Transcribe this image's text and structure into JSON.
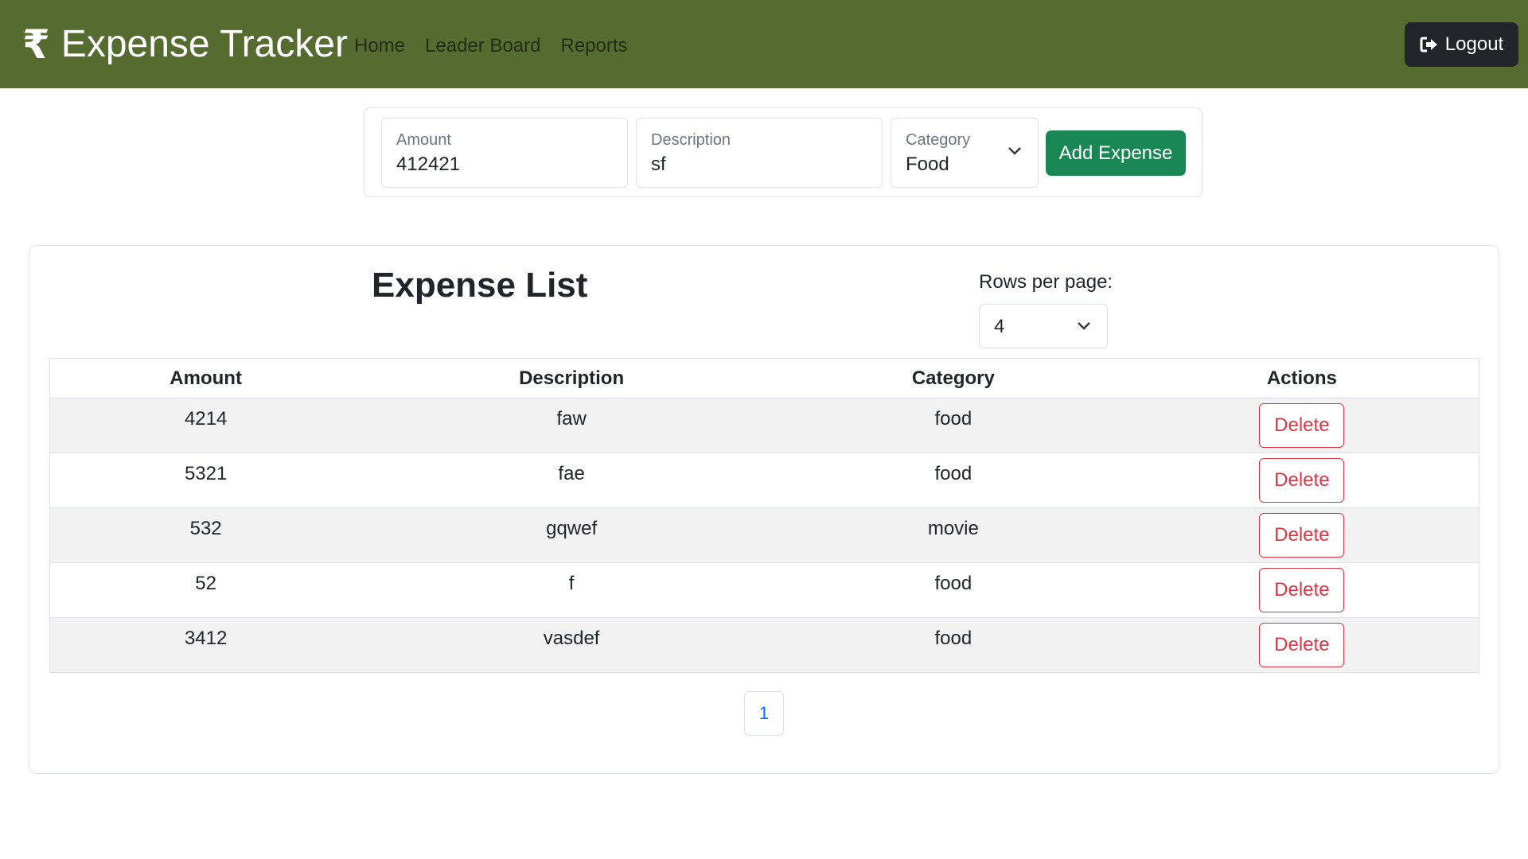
{
  "navbar": {
    "brand_icon": "₹",
    "brand_title": "Expense Tracker",
    "links": [
      "Home",
      "Leader Board",
      "Reports"
    ],
    "logout_label": "Logout"
  },
  "form": {
    "amount_label": "Amount",
    "amount_value": "412421",
    "description_label": "Description",
    "description_value": "sf",
    "category_label": "Category",
    "category_value": "Food",
    "add_button": "Add Expense"
  },
  "list": {
    "title": "Expense List",
    "rows_per_page_label": "Rows per page:",
    "rows_per_page_value": "4",
    "columns": [
      "Amount",
      "Description",
      "Category",
      "Actions"
    ],
    "rows": [
      {
        "amount": "4214",
        "description": "faw",
        "category": "food",
        "action": "Delete"
      },
      {
        "amount": "5321",
        "description": "fae",
        "category": "food",
        "action": "Delete"
      },
      {
        "amount": "532",
        "description": "gqwef",
        "category": "movie",
        "action": "Delete"
      },
      {
        "amount": "52",
        "description": "f",
        "category": "food",
        "action": "Delete"
      },
      {
        "amount": "3412",
        "description": "vasdef",
        "category": "food",
        "action": "Delete"
      }
    ],
    "pages": [
      "1"
    ]
  },
  "colors": {
    "navbar_bg": "#556b2f",
    "add_button_bg": "#198754",
    "delete_accent": "#dc3545",
    "pager_link": "#0d6efd",
    "logout_bg": "#212529"
  },
  "icons": {
    "brand": "rupee-icon",
    "logout": "sign-out-icon",
    "select": "chevron-down-icon"
  }
}
